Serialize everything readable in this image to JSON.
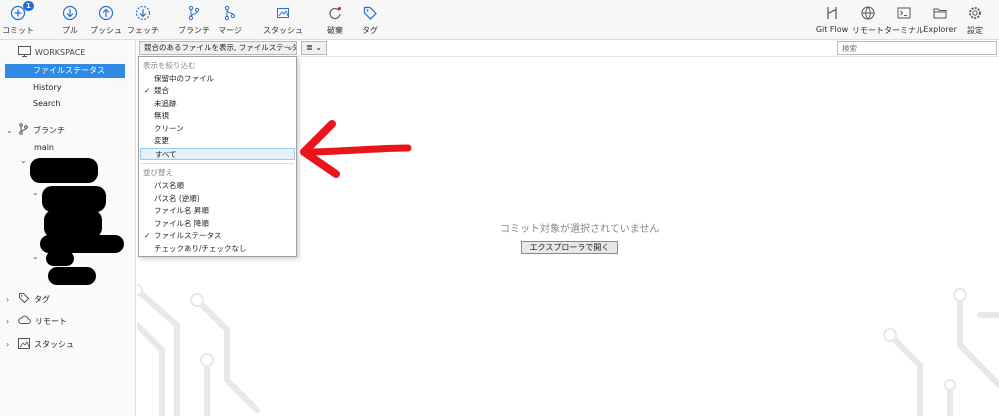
{
  "toolbar": {
    "commit": "コミット",
    "commit_badge": "1",
    "pull": "プル",
    "push": "プッシュ",
    "fetch": "フェッチ",
    "branch": "ブランチ",
    "merge": "マージ",
    "stash": "スタッシュ",
    "discard": "破棄",
    "tag": "タグ",
    "gitflow": "Git Flow",
    "remote": "リモート",
    "terminal": "ターミナル",
    "explorer": "Explorer",
    "settings": "設定"
  },
  "sidebar": {
    "workspace": "WORKSPACE",
    "items": [
      "ファイルステータス",
      "History",
      "Search"
    ],
    "branches": "ブランチ",
    "main_branch": "main",
    "tags": "タグ",
    "remotes": "リモート",
    "stashes": "スタッシュ"
  },
  "subbar": {
    "filter_label": "競合のあるファイルを表示, ファイルステータス順",
    "search_placeholder": "検索"
  },
  "dropdown": {
    "filter_header": "表示を絞り込む",
    "filter_items": [
      "保留中のファイル",
      "競合",
      "未追跡",
      "無視",
      "クリーン",
      "変更",
      "すべて"
    ],
    "sort_header": "並び替え",
    "sort_items": [
      "パス名順",
      "パス名 (逆順)",
      "ファイル名 昇順",
      "ファイル名 降順",
      "ファイルステータス",
      "チェックあり/チェックなし"
    ]
  },
  "main": {
    "message": "コミット対象が選択されていません",
    "open_button": "エクスプローラで開く"
  },
  "colors": {
    "accent": "#2f8ae5",
    "arrow": "#e8161b",
    "highlight": "#e5f1fb"
  }
}
